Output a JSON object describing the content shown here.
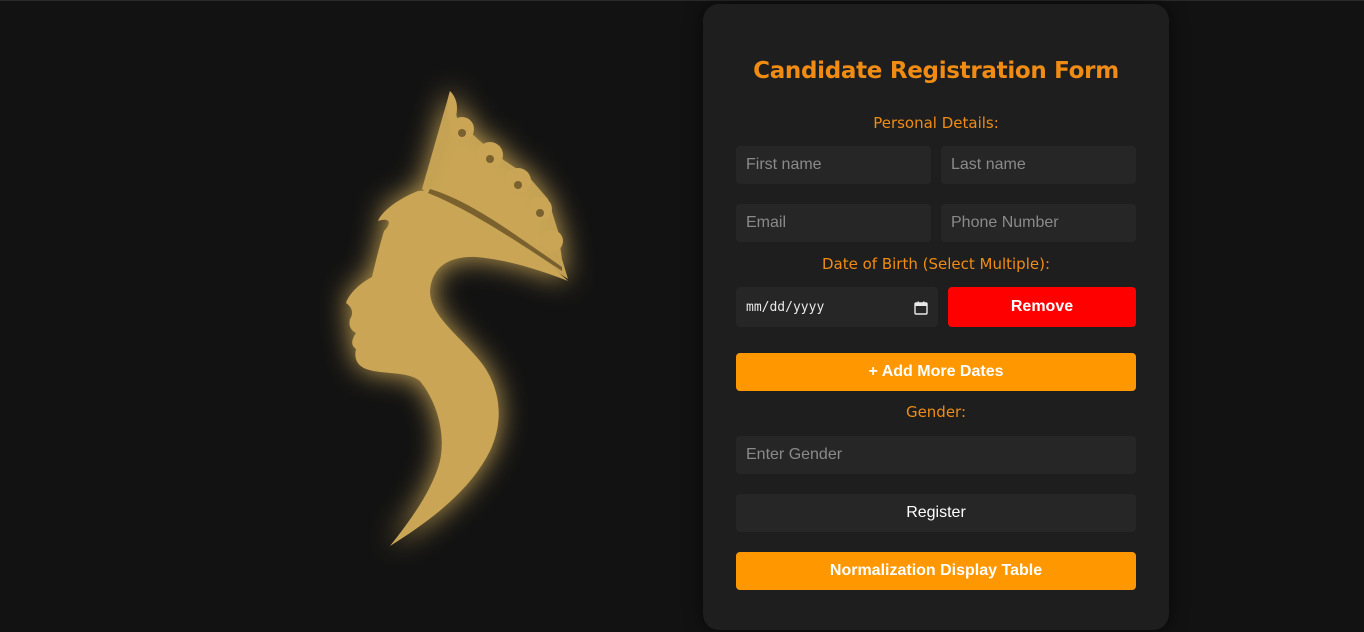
{
  "form": {
    "title": "Candidate Registration Form",
    "personal_details_label": "Personal Details:",
    "first_name_placeholder": "First name",
    "last_name_placeholder": "Last name",
    "email_placeholder": "Email",
    "phone_placeholder": "Phone Number",
    "dob_label": "Date of Birth (Select Multiple):",
    "dob_value": "mm/dd/yyyy",
    "remove_label": "Remove",
    "add_dates_label": "+ Add More Dates",
    "gender_label": "Gender:",
    "gender_placeholder": "Enter Gender",
    "register_label": "Register",
    "normalization_label": "Normalization Display Table"
  },
  "colors": {
    "background": "#121212",
    "card": "#1e1e1e",
    "accent": "#f08c14",
    "orange_button": "#ff9800",
    "remove_button": "#ff0000",
    "illustration_gold": "#c9a555"
  },
  "icons": {
    "date_picker": "calendar-icon",
    "illustration": "queen-silhouette"
  }
}
